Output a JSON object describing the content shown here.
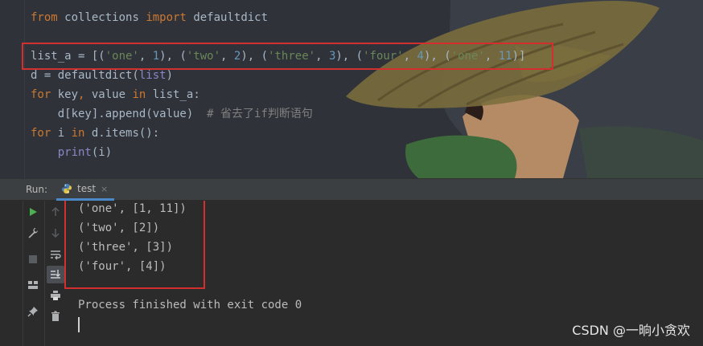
{
  "code_lines": [
    [
      {
        "t": "from ",
        "c": "kw"
      },
      {
        "t": "collections ",
        "c": "id"
      },
      {
        "t": "import ",
        "c": "kw"
      },
      {
        "t": "defaultdict",
        "c": "id"
      }
    ],
    [],
    [
      {
        "t": "list_a = [(",
        "c": "id"
      },
      {
        "t": "'one'",
        "c": "str"
      },
      {
        "t": ", ",
        "c": "id"
      },
      {
        "t": "1",
        "c": "num"
      },
      {
        "t": "), (",
        "c": "id"
      },
      {
        "t": "'two'",
        "c": "str"
      },
      {
        "t": ", ",
        "c": "id"
      },
      {
        "t": "2",
        "c": "num"
      },
      {
        "t": "), (",
        "c": "id"
      },
      {
        "t": "'three'",
        "c": "str"
      },
      {
        "t": ", ",
        "c": "id"
      },
      {
        "t": "3",
        "c": "num"
      },
      {
        "t": "), (",
        "c": "id"
      },
      {
        "t": "'four'",
        "c": "str"
      },
      {
        "t": ", ",
        "c": "id"
      },
      {
        "t": "4",
        "c": "num"
      },
      {
        "t": "), (",
        "c": "id"
      },
      {
        "t": "'one'",
        "c": "str"
      },
      {
        "t": ", ",
        "c": "id"
      },
      {
        "t": "11",
        "c": "num"
      },
      {
        "t": ")]",
        "c": "id"
      }
    ],
    [
      {
        "t": "d = defaultdict(",
        "c": "id"
      },
      {
        "t": "list",
        "c": "bi"
      },
      {
        "t": ")",
        "c": "id"
      }
    ],
    [
      {
        "t": "for ",
        "c": "kw"
      },
      {
        "t": "key",
        "c": "id"
      },
      {
        "t": ", ",
        "c": "kw"
      },
      {
        "t": "value ",
        "c": "id"
      },
      {
        "t": "in ",
        "c": "kw"
      },
      {
        "t": "list_a:",
        "c": "id"
      }
    ],
    [
      {
        "t": "    d[key].append(value)  ",
        "c": "id"
      },
      {
        "t": "# 省去了if判断语句",
        "c": "cm"
      }
    ],
    [
      {
        "t": "for ",
        "c": "kw"
      },
      {
        "t": "i ",
        "c": "id"
      },
      {
        "t": "in ",
        "c": "kw"
      },
      {
        "t": "d.items():",
        "c": "id"
      }
    ],
    [
      {
        "t": "    ",
        "c": "id"
      },
      {
        "t": "print",
        "c": "bi"
      },
      {
        "t": "(i)",
        "c": "id"
      }
    ]
  ],
  "run_panel": {
    "label": "Run:",
    "tab_name": "test",
    "tab_close": "×",
    "output_lines": [
      "('one', [1, 11])",
      "('two', [2])",
      "('three', [3])",
      "('four', [4])",
      "",
      "Process finished with exit code 0"
    ]
  },
  "watermark": "CSDN @一晌小贪欢",
  "colors": {
    "editor_bg": "#2f3238",
    "console_bg": "#2b2b2b",
    "keyword": "#cc7832",
    "string": "#6a8759",
    "number": "#6897bb",
    "highlight_box": "#d32f2f"
  }
}
